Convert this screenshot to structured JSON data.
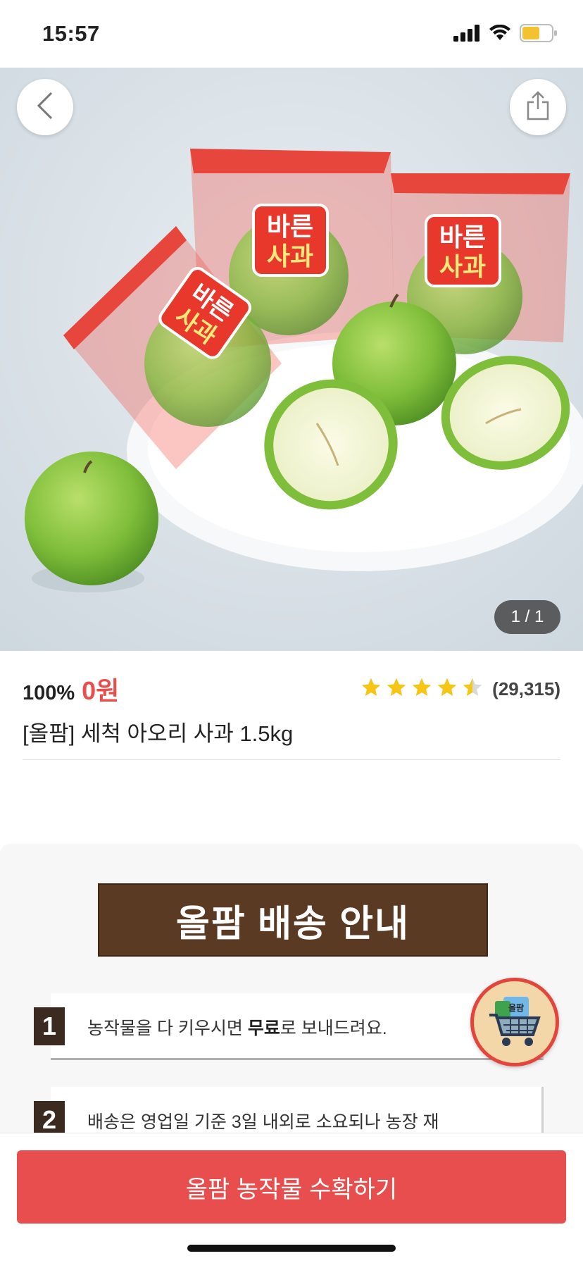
{
  "status_bar": {
    "time": "15:57",
    "icons": [
      "signal-icon",
      "wifi-icon",
      "battery-icon"
    ]
  },
  "hero": {
    "image": "green-apples-on-plate-photo",
    "package_text": "바른 사과",
    "page_indicator": "1 / 1",
    "back_icon": "chevron-left-icon",
    "share_icon": "share-icon"
  },
  "product": {
    "discount": "100%",
    "price": "0원",
    "rating": 4.5,
    "review_count": "(29,315)",
    "name": "[올팜] 세척 아오리 사과 1.5kg"
  },
  "detail": {
    "banner_title": "올팜 배송 안내",
    "steps": [
      {
        "num": "1",
        "text_before": "농작물을 다 키우시면 ",
        "text_bold": "무료",
        "text_after": "로 보내드려요."
      },
      {
        "num": "2",
        "text_before": "배송은 영업일 기준 3일 내외로 소요되나 농장 재",
        "text_bold": "",
        "text_after": ""
      }
    ],
    "cart_badge_label": "올팜"
  },
  "cta": {
    "label": "올팜 농작물 수확하기"
  },
  "colors": {
    "accent_red": "#e94e4e",
    "banner_brown": "#5a3a23",
    "star_yellow": "#f5c518"
  }
}
